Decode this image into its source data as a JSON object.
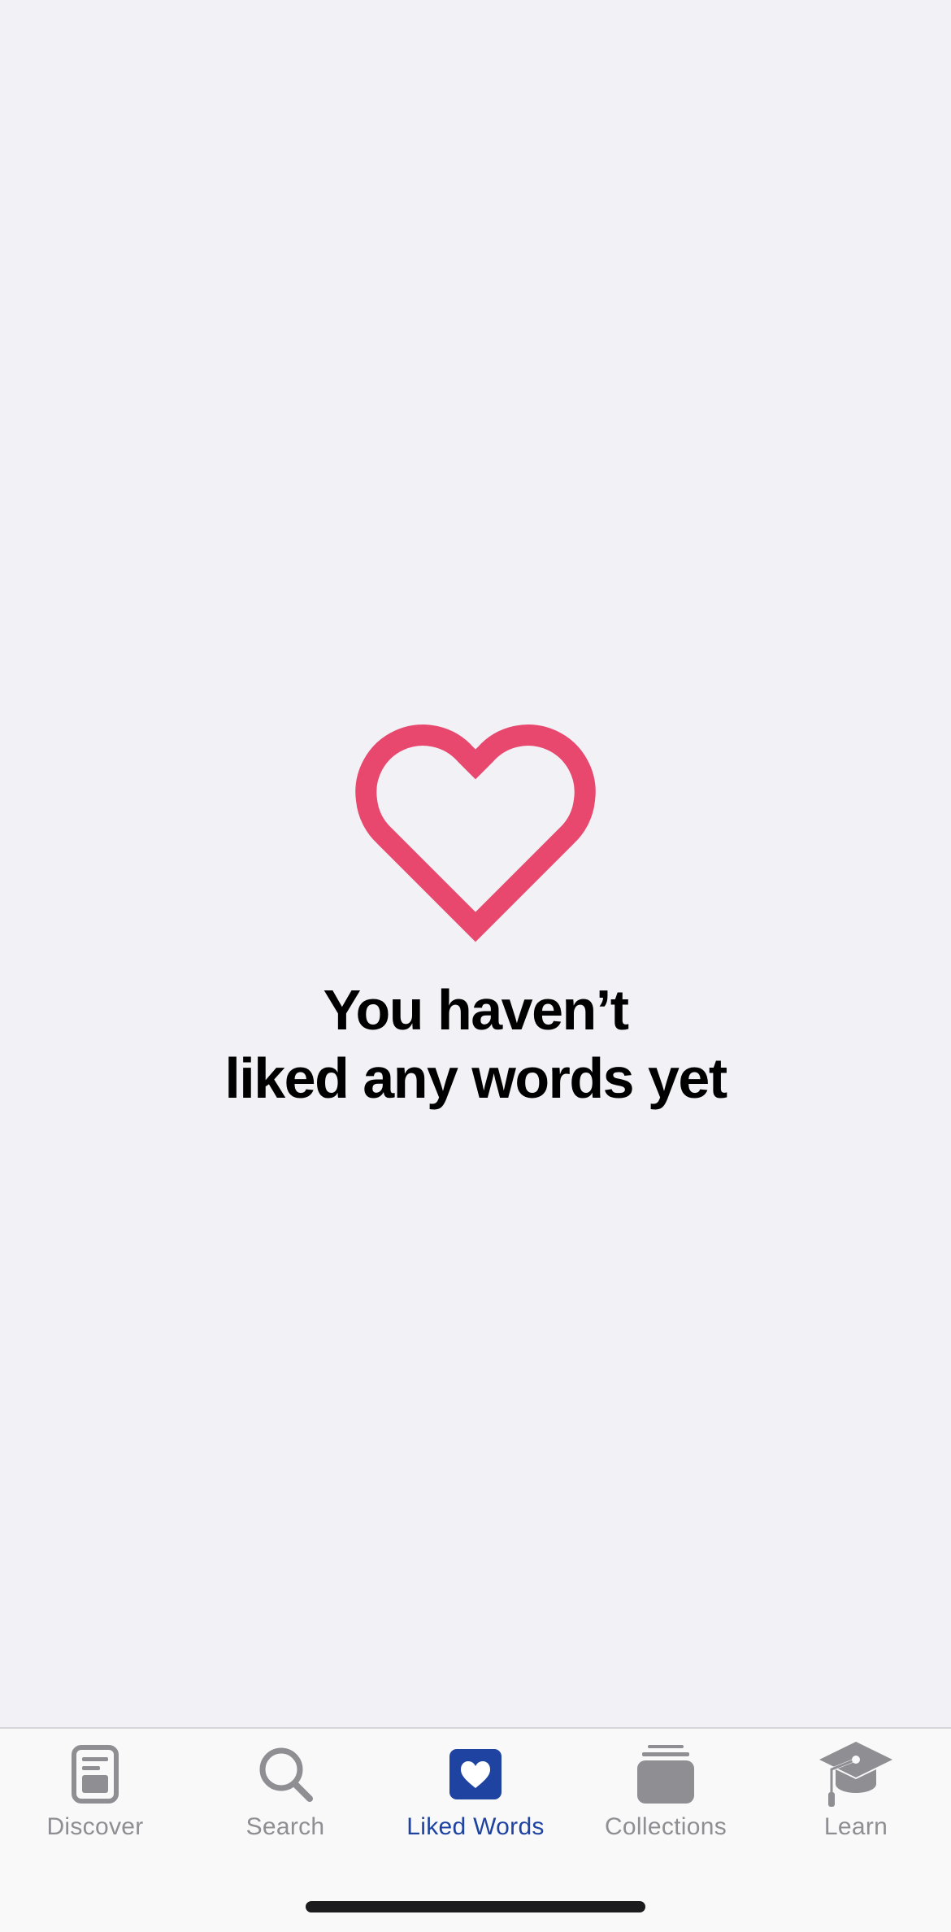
{
  "empty_state": {
    "icon": "heart-outline-icon",
    "icon_color": "#e8486e",
    "title_line1": "You haven’t",
    "title_line2": "liked any words yet"
  },
  "tab_bar": {
    "active_color": "#1e43a1",
    "inactive_color": "#8e8e93",
    "tabs": [
      {
        "label": "Discover",
        "icon": "document-icon",
        "active": false
      },
      {
        "label": "Search",
        "icon": "magnifier-icon",
        "active": false
      },
      {
        "label": "Liked Words",
        "icon": "heart-square-icon",
        "active": true
      },
      {
        "label": "Collections",
        "icon": "stack-icon",
        "active": false
      },
      {
        "label": "Learn",
        "icon": "graduation-cap-icon",
        "active": false
      }
    ]
  }
}
